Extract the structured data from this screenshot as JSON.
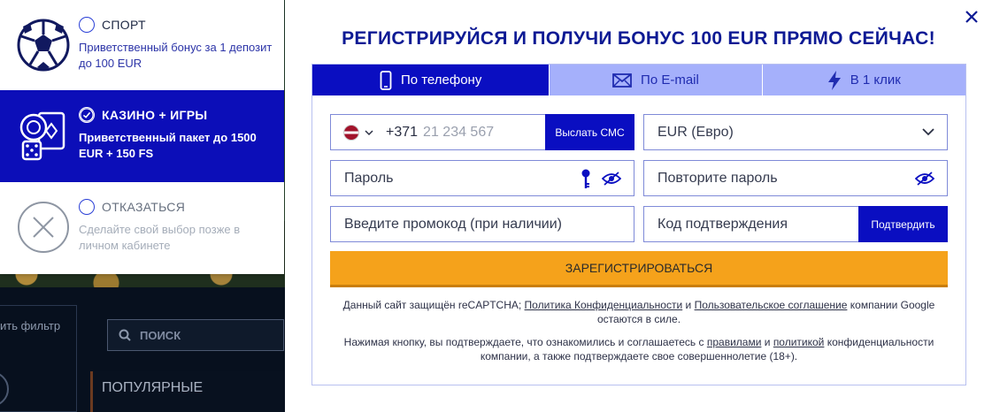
{
  "bonus_panel": {
    "options": [
      {
        "title": "СПОРТ",
        "description": "Приветственный бонус за 1 депозит до 100 EUR"
      },
      {
        "title": "КАЗИНО + ИГРЫ",
        "description": "Приветственный пакет до 1500 EUR + 150 FS"
      },
      {
        "title": "ОТКАЗАТЬСЯ",
        "description": "Сделайте свой выбор позже в личном кабинете"
      }
    ]
  },
  "background": {
    "filter_label": "ить фильтр",
    "search_placeholder": "ПОИСК",
    "popular_label": "ПОПУЛЯРНЫЕ"
  },
  "modal": {
    "title": "РЕГИСТРИРУЙСЯ И ПОЛУЧИ БОНУС 100 EUR ПРЯМО СЕЙЧАС!",
    "tabs": [
      {
        "label": "По телефону"
      },
      {
        "label": "По E-mail"
      },
      {
        "label": "В 1 клик"
      }
    ],
    "form": {
      "dial_code": "+371",
      "phone_placeholder": "21 234 567",
      "sms_button": "Выслать СМС",
      "currency": "EUR (Евро)",
      "password_placeholder": "Пароль",
      "repeat_password_placeholder": "Повторите пароль",
      "promo_placeholder": "Введите промокод (при наличии)",
      "code_placeholder": "Код подтверждения",
      "confirm_button": "Подтвердить",
      "register_button": "ЗАРЕГИСТРИРОВАТЬСЯ"
    },
    "legal": {
      "recaptcha_prefix": "Данный сайт защищён reCAPTCHA;",
      "privacy_link": "Политика Конфиденциальности",
      "and_1": "и",
      "terms_link": "Пользовательское соглашение",
      "recaptcha_suffix": "компании Google остаются в силе.",
      "agree_prefix": "Нажимая кнопку, вы подтверждаете, что ознакомились и соглашаетесь с",
      "rules_link": "правилами",
      "and_2": "и",
      "policy_link": "политикой",
      "agree_suffix": "конфиденциальности компании, а также подтверждаете свое совершеннолетие (18+)."
    }
  },
  "colors": {
    "primary_blue": "#0a0ec1",
    "title_blue": "#0d1a94",
    "inactive_tab": "#a5b0fb",
    "register_orange": "#f5a21b"
  }
}
